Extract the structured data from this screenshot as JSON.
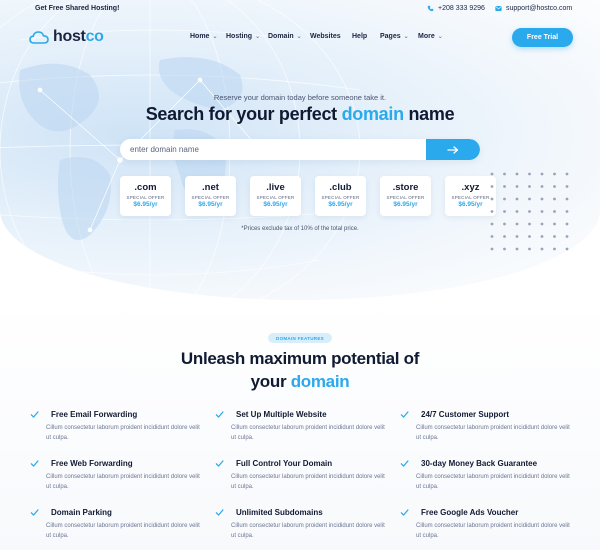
{
  "topbar": {
    "promo": "Get Free Shared Hosting!",
    "phone": "+208 333 9296",
    "email": "support@hostco.com"
  },
  "nav": {
    "logo_host": "host",
    "logo_co": "co",
    "items": [
      {
        "label": "Home",
        "dropdown": true
      },
      {
        "label": "Hosting",
        "dropdown": true
      },
      {
        "label": "Domain",
        "dropdown": true
      },
      {
        "label": "Websites",
        "dropdown": false
      },
      {
        "label": "Help",
        "dropdown": false
      },
      {
        "label": "Pages",
        "dropdown": true
      },
      {
        "label": "More",
        "dropdown": true
      }
    ],
    "cta": "Free Trial"
  },
  "hero": {
    "tagline": "Reserve your domain today before someone take it.",
    "title_before": "Search for your perfect ",
    "title_highlight": "domain",
    "title_after": " name",
    "search_placeholder": "enter domain name",
    "tlds": [
      {
        "ext": ".com",
        "offer": "SPECIAL OFFER",
        "price": "$6.95/yr"
      },
      {
        "ext": ".net",
        "offer": "SPECIAL OFFER",
        "price": "$6.95/yr"
      },
      {
        "ext": ".live",
        "offer": "SPECIAL OFFER",
        "price": "$6.95/yr"
      },
      {
        "ext": ".club",
        "offer": "SPECIAL OFFER",
        "price": "$6.95/yr"
      },
      {
        "ext": ".store",
        "offer": "SPECIAL OFFER",
        "price": "$6.95/yr"
      },
      {
        "ext": ".xyz",
        "offer": "SPECIAL OFFER",
        "price": "$6.95/yr"
      }
    ],
    "tax_note": "*Prices exclude tax of 10% of the total price."
  },
  "features": {
    "badge": "DOMAIN FEATURES",
    "title_line1": "Unleash maximum potential of",
    "title_line2_before": "your ",
    "title_line2_highlight": "domain",
    "items": [
      {
        "name": "Free Email Forwarding",
        "desc": "Cillum consectetur laborum proident incididunt dolore velit ut culpa."
      },
      {
        "name": "Set Up Multiple Website",
        "desc": "Cillum consectetur laborum proident incididunt dolore velit ut culpa."
      },
      {
        "name": "24/7 Customer Support",
        "desc": "Cillum consectetur laborum proident incididunt dolore velit ut culpa."
      },
      {
        "name": "Free Web Forwarding",
        "desc": "Cillum consectetur laborum proident incididunt dolore velit ut culpa."
      },
      {
        "name": "Full Control Your Domain",
        "desc": "Cillum consectetur laborum proident incididunt dolore velit ut culpa."
      },
      {
        "name": "30-day Money Back Guarantee",
        "desc": "Cillum consectetur laborum proident incididunt dolore velit ut culpa."
      },
      {
        "name": "Domain Parking",
        "desc": "Cillum consectetur laborum proident incididunt dolore velit ut culpa."
      },
      {
        "name": "Unlimited Subdomains",
        "desc": "Cillum consectetur laborum proident incididunt dolore velit ut culpa."
      },
      {
        "name": "Free Google Ads Voucher",
        "desc": "Cillum consectetur laborum proident incididunt dolore velit ut culpa."
      }
    ]
  },
  "colors": {
    "accent": "#2aa9ec",
    "heading": "#111a33",
    "muted": "#6c7694"
  },
  "icons": {
    "logo": "cloud-icon",
    "phone": "phone-icon",
    "email": "mail-icon",
    "search": "arrow-right-icon",
    "feature": "check-icon"
  }
}
